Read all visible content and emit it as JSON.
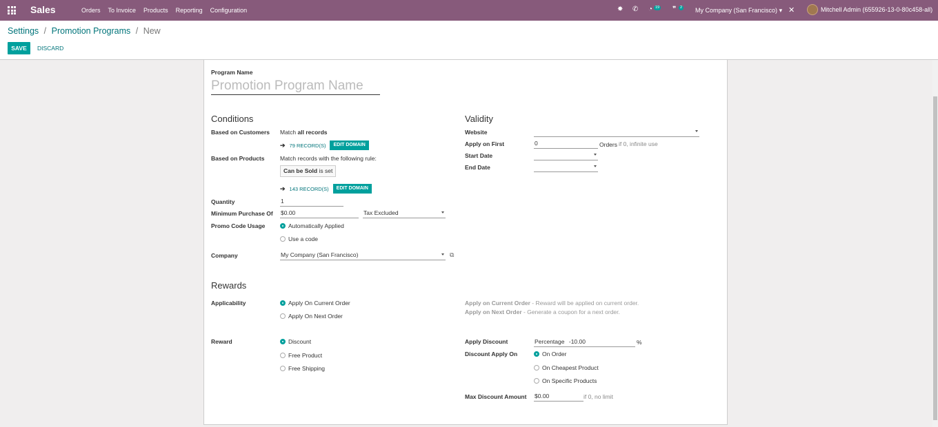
{
  "app": {
    "brand": "Sales"
  },
  "menu": [
    "Orders",
    "To Invoice",
    "Products",
    "Reporting",
    "Configuration"
  ],
  "systray": {
    "activity_count": "19",
    "messages_count": "2",
    "company": "My Company (San Francisco)",
    "user": "Mitchell Admin (655926-13-0-80c458-all)"
  },
  "breadcrumb": {
    "settings": "Settings",
    "programs": "Promotion Programs",
    "current": "New",
    "sep": "/"
  },
  "buttons": {
    "save": "SAVE",
    "discard": "DISCARD"
  },
  "form": {
    "program_name_label": "Program Name",
    "program_name_placeholder": "Promotion Program Name",
    "conditions": {
      "title": "Conditions",
      "based_on_customers_label": "Based on Customers",
      "match_prefix": "Match",
      "match_all": "all records",
      "customers_records": "79 RECORD(S)",
      "edit_domain": "EDIT DOMAIN",
      "based_on_products_label": "Based on Products",
      "match_rule": "Match records with the following rule:",
      "rule_field": "Can be Sold",
      "rule_op": "is set",
      "products_records": "143 RECORD(S)",
      "quantity_label": "Quantity",
      "quantity_value": "1",
      "min_purchase_label": "Minimum Purchase Of",
      "min_purchase_value": "$0.00",
      "tax_mode": "Tax Excluded",
      "promo_code_label": "Promo Code Usage",
      "promo_options": [
        "Automatically Applied",
        "Use a code"
      ],
      "company_label": "Company",
      "company_value": "My Company (San Francisco)"
    },
    "validity": {
      "title": "Validity",
      "website_label": "Website",
      "website_value": "",
      "apply_first_label": "Apply on First",
      "apply_first_value": "0",
      "orders_suffix": "Orders",
      "orders_help": "if 0, infinite use",
      "start_date_label": "Start Date",
      "end_date_label": "End Date"
    },
    "rewards": {
      "title": "Rewards",
      "applicability_label": "Applicability",
      "applicability_options": [
        "Apply On Current Order",
        "Apply On Next Order"
      ],
      "help_current_bold": "Apply on Current Order",
      "help_current_text": " - Reward will be applied on current order.",
      "help_next_bold": "Apply on Next Order",
      "help_next_text": " - Generate a coupon for a next order.",
      "reward_label": "Reward",
      "reward_options": [
        "Discount",
        "Free Product",
        "Free Shipping"
      ],
      "apply_discount_label": "Apply Discount",
      "discount_type": "Percentage",
      "discount_value": "-10.00",
      "discount_unit": "%",
      "discount_apply_on_label": "Discount Apply On",
      "apply_on_options": [
        "On Order",
        "On Cheapest Product",
        "On Specific Products"
      ],
      "max_discount_label": "Max Discount Amount",
      "max_discount_value": "$0.00",
      "max_discount_help": "if 0, no limit"
    }
  }
}
